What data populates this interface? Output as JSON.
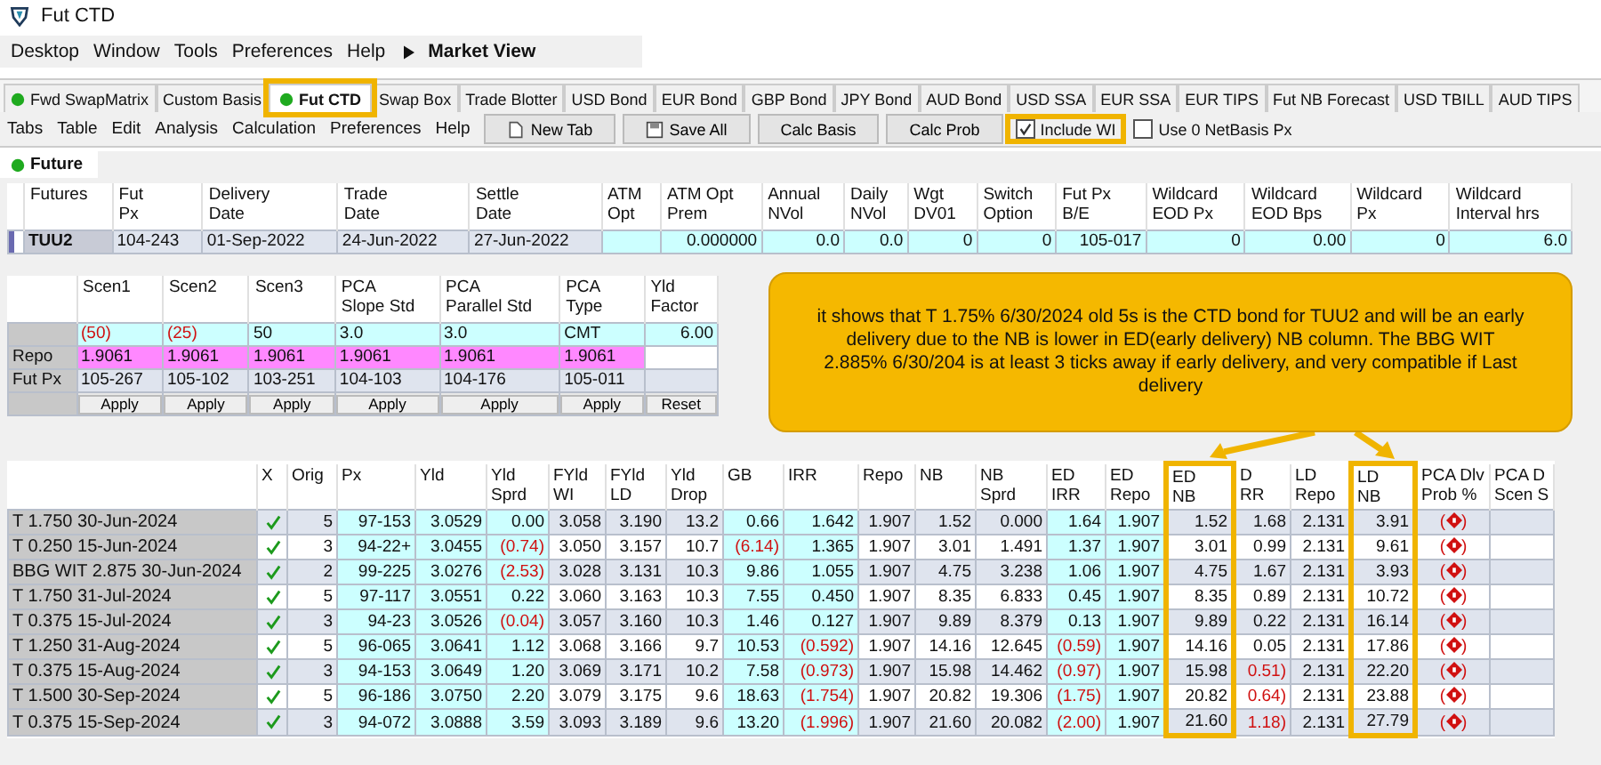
{
  "window": {
    "title": "Fut CTD"
  },
  "menubar": {
    "items": [
      "Desktop",
      "Window",
      "Tools",
      "Preferences",
      "Help"
    ],
    "view_title": "Market View"
  },
  "tabs": [
    {
      "label": "Fwd SwapMatrix",
      "selected": false,
      "indicator": true,
      "highlighted": false
    },
    {
      "label": "Custom Basis",
      "selected": false,
      "indicator": false,
      "highlighted": false
    },
    {
      "label": "Fut CTD",
      "selected": true,
      "indicator": true,
      "highlighted": true
    },
    {
      "label": "Swap Box",
      "selected": false,
      "indicator": false,
      "highlighted": false
    },
    {
      "label": "Trade Blotter",
      "selected": false,
      "indicator": false,
      "highlighted": false
    },
    {
      "label": "USD Bond",
      "selected": false,
      "indicator": false,
      "highlighted": false
    },
    {
      "label": "EUR Bond",
      "selected": false,
      "indicator": false,
      "highlighted": false
    },
    {
      "label": "GBP Bond",
      "selected": false,
      "indicator": false,
      "highlighted": false
    },
    {
      "label": "JPY Bond",
      "selected": false,
      "indicator": false,
      "highlighted": false
    },
    {
      "label": "AUD Bond",
      "selected": false,
      "indicator": false,
      "highlighted": false
    },
    {
      "label": "USD SSA",
      "selected": false,
      "indicator": false,
      "highlighted": false
    },
    {
      "label": "EUR SSA",
      "selected": false,
      "indicator": false,
      "highlighted": false
    },
    {
      "label": "EUR TIPS",
      "selected": false,
      "indicator": false,
      "highlighted": false
    },
    {
      "label": "Fut NB Forecast",
      "selected": false,
      "indicator": false,
      "highlighted": false
    },
    {
      "label": "USD TBILL",
      "selected": false,
      "indicator": false,
      "highlighted": false
    },
    {
      "label": "AUD TIPS",
      "selected": false,
      "indicator": false,
      "highlighted": false
    }
  ],
  "toolbar": {
    "menu": [
      "Tabs",
      "Table",
      "Edit",
      "Analysis",
      "Calculation",
      "Preferences",
      "Help"
    ],
    "buttons": [
      {
        "label": "New Tab",
        "kind": "new"
      },
      {
        "label": "Save All",
        "kind": "save"
      },
      {
        "label": "Calc Basis",
        "kind": "plain"
      },
      {
        "label": "Calc Prob",
        "kind": "plain"
      }
    ],
    "checkboxes": [
      {
        "label": "Include WI",
        "checked": true,
        "highlighted": true
      },
      {
        "label": "Use 0 NetBasis Px",
        "checked": false,
        "highlighted": false
      }
    ]
  },
  "subtabs": [
    {
      "label": "Future",
      "selected": true,
      "indicator": true
    }
  ],
  "futures_table": {
    "columns": [
      "Futures",
      "Fut\nPx",
      "Delivery\nDate",
      "Trade\nDate",
      "Settle\nDate",
      "ATM\nOpt",
      "ATM Opt\nPrem",
      "Annual\nNVol",
      "Daily\nNVol",
      "Wgt\nDV01",
      "Switch\nOption",
      "Fut Px\nB/E",
      "Wildcard\nEOD Px",
      "Wildcard\nEOD Bps",
      "Wildcard\nPx",
      "Wildcard\nInterval hrs"
    ],
    "rows": [
      [
        "TUU2",
        "104-243",
        "01-Sep-2022",
        "24-Jun-2022",
        "27-Jun-2022",
        null,
        "0.000000",
        "0.0",
        "0.0",
        "0",
        "0",
        "105-017",
        "0",
        "0.00",
        "0",
        "6.0"
      ]
    ]
  },
  "scenario_table": {
    "columns": [
      "Scen1",
      "Scen2",
      "Scen3",
      "PCA\nSlope Std",
      "PCA\nParallel Std",
      "PCA\nType",
      "Yld\nFactor"
    ],
    "rows": [
      {
        "kind": "scenario",
        "label": null,
        "cells": [
          {
            "text": "(50)",
            "negative": true
          },
          {
            "text": "(25)",
            "negative": true
          },
          "50",
          "3.0",
          "3.0",
          "CMT",
          "6.00"
        ]
      },
      {
        "kind": "repo",
        "label": "Repo",
        "cells": [
          "1.9061",
          "1.9061",
          "1.9061",
          "1.9061",
          "1.9061",
          "1.9061",
          null
        ]
      },
      {
        "kind": "price",
        "label": "Fut Px",
        "cells": [
          "105-267",
          "105-102",
          "103-251",
          "104-103",
          "104-176",
          "105-011",
          null
        ]
      }
    ],
    "buttons": [
      "Apply",
      "Apply",
      "Apply",
      "Apply",
      "Apply",
      "Apply",
      "Reset"
    ]
  },
  "callout": {
    "text": "it shows that T 1.75% 6/30/2024 old 5s is the CTD bond for TUU2 and will be an early delivery due to the NB is lower in ED(early delivery) NB column. The BBG WIT 2.885% 6/30/204 is at least 3 ticks away if early delivery, and very compatible if Last delivery"
  },
  "bond_table": {
    "columns": [
      {
        "highlighted": false
      },
      {
        "header": "X",
        "highlighted": false
      },
      {
        "header": "Orig",
        "highlighted": false
      },
      {
        "header": "Px",
        "highlighted": false
      },
      {
        "header": "Yld",
        "highlighted": false
      },
      {
        "header": "Yld\nSprd",
        "highlighted": false
      },
      {
        "header": "FYld\nWI",
        "highlighted": false
      },
      {
        "header": "FYld\nLD",
        "highlighted": false
      },
      {
        "header": "Yld\nDrop",
        "highlighted": false
      },
      {
        "header": "GB",
        "highlighted": false
      },
      {
        "header": "IRR",
        "highlighted": false
      },
      {
        "header": "Repo",
        "highlighted": false
      },
      {
        "header": "NB",
        "highlighted": false
      },
      {
        "header": "NB\nSprd",
        "highlighted": false
      },
      {
        "header": "ED\nIRR",
        "highlighted": false
      },
      {
        "header": "ED\nRepo",
        "highlighted": false
      },
      {
        "header": "ED\nNB",
        "highlighted": true
      },
      {
        "header": "D\nRR",
        "highlighted": false
      },
      {
        "header": "LD\nRepo",
        "highlighted": false
      },
      {
        "header": "LD\nNB",
        "highlighted": true
      },
      {
        "header": "PCA Dlv\nProb %",
        "highlighted": false
      },
      {
        "header": "PCA D\nScen S",
        "highlighted": false
      }
    ],
    "rows": [
      {
        "cells": [
          "T 1.750 30-Jun-2024",
          {
            "checked": true
          },
          "5",
          "97-153",
          "3.0529",
          "0.00",
          "3.058",
          "3.190",
          "13.2",
          "0.66",
          "1.642",
          "1.907",
          "1.52",
          "0.000",
          "1.64",
          "1.907",
          "1.52",
          "1.68",
          "2.131",
          "3.91",
          {
            "open": "(",
            "close": ")",
            "negative": true
          },
          null
        ]
      },
      {
        "cells": [
          "T 0.250 15-Jun-2024",
          {
            "checked": true
          },
          "3",
          "94-22+",
          "3.0455",
          {
            "text": "(0.74)",
            "negative": true
          },
          "3.050",
          "3.157",
          "10.7",
          {
            "text": "(6.14)",
            "negative": true
          },
          "1.365",
          "1.907",
          "3.01",
          "1.491",
          "1.37",
          "1.907",
          "3.01",
          "0.99",
          "2.131",
          "9.61",
          {
            "open": "(",
            "close": ")",
            "negative": true
          },
          null
        ]
      },
      {
        "cells": [
          "BBG WIT 2.875 30-Jun-2024",
          {
            "checked": true
          },
          "2",
          "99-225",
          "3.0276",
          {
            "text": "(2.53)",
            "negative": true
          },
          "3.028",
          "3.131",
          "10.3",
          "9.86",
          "1.055",
          "1.907",
          "4.75",
          "3.238",
          "1.06",
          "1.907",
          "4.75",
          "1.67",
          "2.131",
          "3.93",
          {
            "open": "(",
            "close": ")",
            "negative": true
          },
          null
        ]
      },
      {
        "cells": [
          "T 1.750 31-Jul-2024",
          {
            "checked": true
          },
          "5",
          "97-117",
          "3.0551",
          "0.22",
          "3.060",
          "3.163",
          "10.3",
          "7.55",
          "0.450",
          "1.907",
          "8.35",
          "6.833",
          "0.45",
          "1.907",
          "8.35",
          "0.89",
          "2.131",
          "10.72",
          {
            "open": "(",
            "close": ")",
            "negative": true
          },
          null
        ]
      },
      {
        "cells": [
          "T 0.375 15-Jul-2024",
          {
            "checked": true
          },
          "3",
          "94-23",
          "3.0526",
          {
            "text": "(0.04)",
            "negative": true
          },
          "3.057",
          "3.160",
          "10.3",
          "1.46",
          "0.127",
          "1.907",
          "9.89",
          "8.379",
          "0.13",
          "1.907",
          "9.89",
          "0.22",
          "2.131",
          "16.14",
          {
            "open": "(",
            "close": ")",
            "negative": true
          },
          null
        ]
      },
      {
        "cells": [
          "T 1.250 31-Aug-2024",
          {
            "checked": true
          },
          "5",
          "96-065",
          "3.0641",
          "1.12",
          "3.068",
          "3.166",
          "9.7",
          "10.53",
          {
            "text": "(0.592)",
            "negative": true
          },
          "1.907",
          "14.16",
          "12.645",
          {
            "text": "(0.59)",
            "negative": true
          },
          "1.907",
          "14.16",
          "0.05",
          "2.131",
          "17.86",
          {
            "open": "(",
            "close": ")",
            "negative": true
          },
          null
        ]
      },
      {
        "cells": [
          "T 0.375 15-Aug-2024",
          {
            "checked": true
          },
          "3",
          "94-153",
          "3.0649",
          "1.20",
          "3.069",
          "3.171",
          "10.2",
          "7.58",
          {
            "text": "(0.973)",
            "negative": true
          },
          "1.907",
          "15.98",
          "14.462",
          {
            "text": "(0.97)",
            "negative": true
          },
          "1.907",
          "15.98",
          {
            "text": "0.51)",
            "negative": true
          },
          "2.131",
          "22.20",
          {
            "open": "(",
            "close": ")",
            "negative": true
          },
          null
        ]
      },
      {
        "cells": [
          "T 1.500 30-Sep-2024",
          {
            "checked": true
          },
          "5",
          "96-186",
          "3.0750",
          "2.20",
          "3.079",
          "3.175",
          "9.6",
          "18.63",
          {
            "text": "(1.754)",
            "negative": true
          },
          "1.907",
          "20.82",
          "19.306",
          {
            "text": "(1.75)",
            "negative": true
          },
          "1.907",
          "20.82",
          {
            "text": "0.64)",
            "negative": true
          },
          "2.131",
          "23.88",
          {
            "open": "(",
            "close": ")",
            "negative": true
          },
          null
        ]
      },
      {
        "cells": [
          "T 0.375 15-Sep-2024",
          {
            "checked": true
          },
          "3",
          "94-072",
          "3.0888",
          "3.59",
          "3.093",
          "3.189",
          "9.6",
          "13.20",
          {
            "text": "(1.996)",
            "negative": true
          },
          "1.907",
          "21.60",
          "20.082",
          {
            "text": "(2.00)",
            "negative": true
          },
          "1.907",
          "21.60",
          {
            "text": "1.18)",
            "negative": true
          },
          "2.131",
          "27.79",
          {
            "open": "(",
            "close": ")",
            "negative": true
          },
          null
        ]
      }
    ]
  }
}
